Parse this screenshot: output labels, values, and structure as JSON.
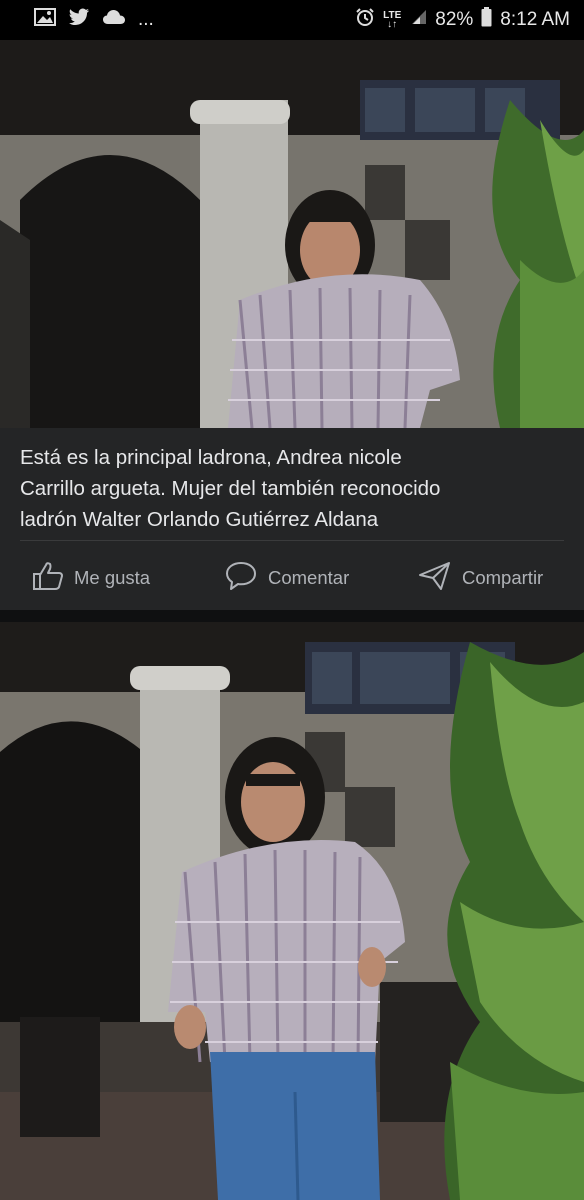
{
  "status_bar": {
    "notification_icons": [
      "image-icon",
      "twitter-icon",
      "cloud-icon"
    ],
    "overflow": "...",
    "alarm_icon": "alarm-icon",
    "network": "LTE",
    "battery_percent": "82%",
    "time": "8:12 AM"
  },
  "post": {
    "caption_line1": "Está es la principal ladrona, Andrea nicole",
    "caption_line2": "Carrillo argueta. Mujer del también reconocido",
    "caption_line3": "ladrón Walter Orlando Gutiérrez Aldana",
    "actions": {
      "like": "Me gusta",
      "comment": "Comentar",
      "share": "Compartir"
    }
  },
  "colors": {
    "card_background": "#242526",
    "caption_text": "#e6e7e9",
    "action_text": "#b0b3b8",
    "divider": "#3a3b3c"
  }
}
